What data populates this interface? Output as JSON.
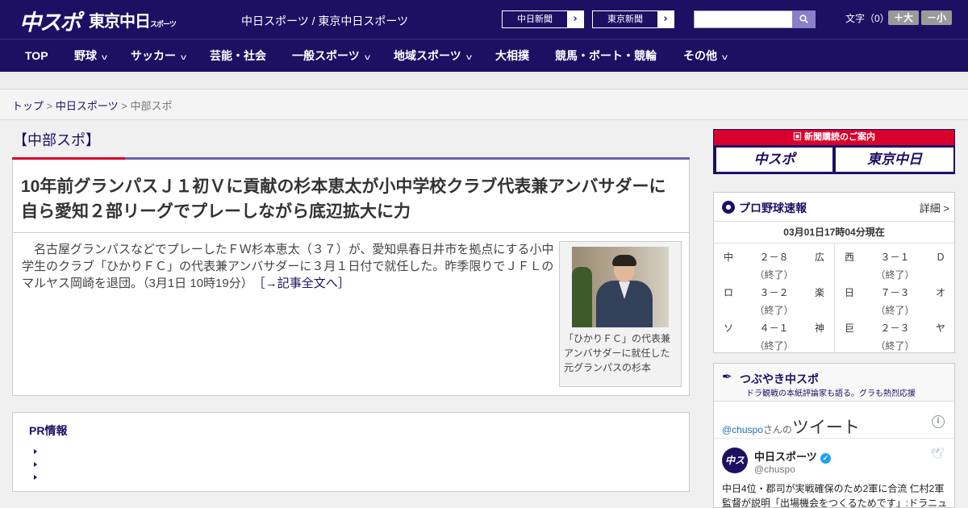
{
  "header": {
    "logo_main": "中スポ",
    "logo_tokyo": "東京中日",
    "logo_tokyo_small": "スポーツ",
    "site_names": "中日スポーツ / 東京中日スポーツ",
    "buttons": [
      {
        "label": "中日新聞"
      },
      {
        "label": "東京新聞"
      }
    ],
    "search": {
      "placeholder": ""
    },
    "font_size_label": "文字（0）",
    "font_larger": "＋大",
    "font_smaller": "－小"
  },
  "nav": [
    {
      "label": "TOP",
      "dropdown": false
    },
    {
      "label": "野球",
      "dropdown": true
    },
    {
      "label": "サッカー",
      "dropdown": true
    },
    {
      "label": "芸能・社会",
      "dropdown": false
    },
    {
      "label": "一般スポーツ",
      "dropdown": true
    },
    {
      "label": "地域スポーツ",
      "dropdown": true
    },
    {
      "label": "大相撲",
      "dropdown": false
    },
    {
      "label": "競馬・ボート・競輪",
      "dropdown": false
    },
    {
      "label": "その他",
      "dropdown": true
    }
  ],
  "breadcrumb": {
    "top": "トップ",
    "sep": ">",
    "section": "中日スポーツ",
    "current": "中部スポ"
  },
  "article": {
    "section_title": "【中部スポ】",
    "headline": "10年前グランパスＪ１初Ｖに貢献の杉本恵太が小中学校クラブ代表兼アンバサダーに　自ら愛知２部リーグでプレーしながら底辺拡大に力",
    "lead": "名古屋グランパスなどでプレーしたＦＷ杉本恵太（３７）が、愛知県春日井市を拠点にする小中学生のクラブ「ひかりＦＣ」の代表兼アンバサダーに３月１日付で就任した。昨季限りでＪＦＬのマルヤス岡崎を退団。（3月1日 10時19分）",
    "more_link": "［→記事全文へ］",
    "photo_caption": "「ひかりＦＣ」の代表兼アンバサダーに就任した元グランパスの杉本"
  },
  "pr": {
    "title": "PR情報",
    "items": [
      "",
      "",
      ""
    ]
  },
  "subscribe": {
    "top": "新聞購読のご案内",
    "logo1": "中スポ",
    "logo2": "東京中日"
  },
  "baseball": {
    "title": "プロ野球速報",
    "more": "詳細 >",
    "time": "03月01日17時04分現在",
    "games": [
      {
        "home": "中",
        "score": "２－８",
        "status": "（終了）",
        "away": "広"
      },
      {
        "home": "ロ",
        "score": "３－２",
        "status": "（終了）",
        "away": "楽"
      },
      {
        "home": "ソ",
        "score": "４－１",
        "status": "（終了）",
        "away": "神"
      },
      {
        "home": "西",
        "score": "３－１",
        "status": "（終了）",
        "away": "Ｄ"
      },
      {
        "home": "日",
        "score": "７－３",
        "status": "（終了）",
        "away": "オ"
      },
      {
        "home": "巨",
        "score": "２－３",
        "status": "（終了）",
        "away": "ヤ"
      }
    ]
  },
  "twitter": {
    "title": "つぶやき中スポ",
    "subtitle": "ドラ観戦の本紙評論家も語る。グラも熱烈応援",
    "user_link": "@chuspo",
    "user_suffix": "さんの",
    "tweets_label": "ツイート",
    "avatar_text": "中スポ",
    "name": "中日スポーツ",
    "handle": "@chuspo",
    "text": "中日4位・郡司が実戦確保のため2軍に合流 仁村2軍監督が説明「出場機会をつくるためです」:ドラニュ"
  },
  "colors": {
    "brand_navy": "#1d1063",
    "accent_red": "#d8002d",
    "link_blue": "#1b70b6"
  }
}
